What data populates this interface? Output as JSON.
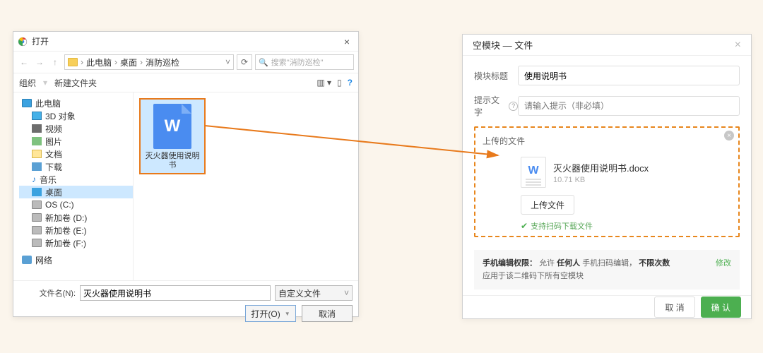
{
  "fileDialog": {
    "title": "打开",
    "breadcrumb": {
      "b0": "此电脑",
      "b1": "桌面",
      "b2": "消防巡检"
    },
    "search_placeholder": "搜索\"消防巡检\"",
    "toolbar": {
      "organize": "组织",
      "newfolder": "新建文件夹"
    },
    "sidebar": {
      "pc": "此电脑",
      "d3d": "3D 对象",
      "video": "视频",
      "images": "图片",
      "docs": "文档",
      "downloads": "下载",
      "music": "音乐",
      "desktop": "桌面",
      "osc": "OS (C:)",
      "voldd": "新加卷 (D:)",
      "volde": "新加卷 (E:)",
      "voldf": "新加卷 (F:)",
      "network": "网络"
    },
    "file": {
      "name": "灭火器使用说明书"
    },
    "footer": {
      "filename_label": "文件名(N):",
      "filename_value": "灭火器使用说明书",
      "filter": "自定义文件",
      "open": "打开(O)",
      "cancel": "取消"
    }
  },
  "uploadPanel": {
    "title": "空模块 — 文件",
    "form": {
      "title_label": "模块标题",
      "title_value": "使用说明书",
      "hint_label": "提示文字",
      "hint_placeholder": "请输入提示（非必填）",
      "uploaded_label": "上传的文件"
    },
    "file": {
      "name": "灭火器使用说明书.docx",
      "size": "10.71 KB"
    },
    "upload_btn": "上传文件",
    "scan_tip": "支持扫码下载文件",
    "perm": {
      "label": "手机编辑权限：",
      "allow": "允许",
      "anyone": "任何人",
      "mid": "手机扫码编辑，",
      "unlimited": "不限次数",
      "note": "应用于该二维码下所有空模块",
      "modify": "修改"
    },
    "footer": {
      "cancel": "取 消",
      "confirm": "确 认"
    }
  }
}
